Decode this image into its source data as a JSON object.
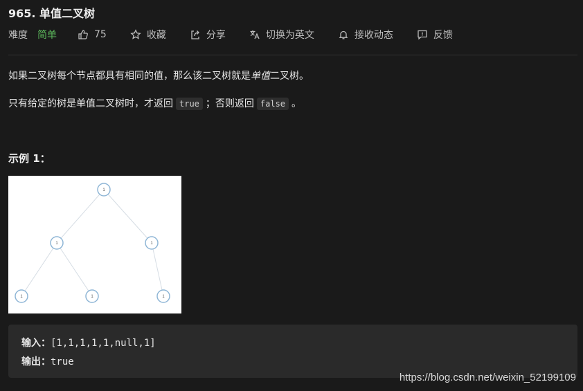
{
  "problem": {
    "title": "965. 单值二叉树",
    "difficulty_label": "难度",
    "difficulty": "简单",
    "likes": "75",
    "actions": {
      "collect": "收藏",
      "share": "分享",
      "switch_lang": "切换为英文",
      "notify": "接收动态",
      "feedback": "反馈"
    }
  },
  "description": {
    "p1_before": "如果二叉树每个节点都具有相同的值，那么该二叉树就是",
    "p1_em": "单值",
    "p1_after": "二叉树。",
    "p2_before": "只有给定的树是单值二叉树时，才返回",
    "code_true": "true",
    "p2_middle": "；否则返回",
    "code_false": "false",
    "p2_after": "。"
  },
  "example": {
    "title": "示例 1：",
    "input_label": "输入：",
    "input_value": "[1,1,1,1,1,null,1]",
    "output_label": "输出：",
    "output_value": "true",
    "tree_nodes": [
      "1",
      "1",
      "1",
      "1",
      "1",
      "1"
    ]
  },
  "watermark": "https://blog.csdn.net/weixin_52199109",
  "colors": {
    "accent_easy": "#5cb85c",
    "node_stroke": "#8fb6d6",
    "edge": "#d6dde4"
  }
}
